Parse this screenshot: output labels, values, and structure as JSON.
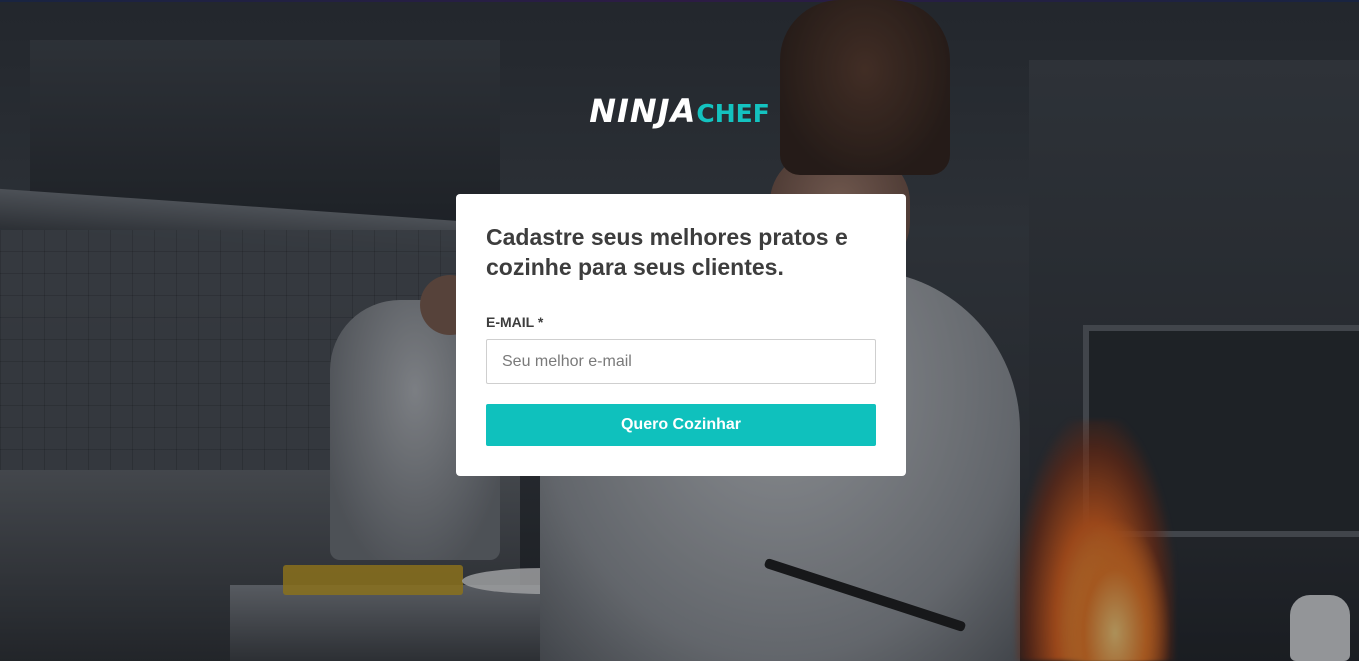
{
  "logo": {
    "part1": "NINJA",
    "part2": "CHEF",
    "part1_color": "#ffffff",
    "part2_color": "#14c3c0"
  },
  "form": {
    "title": "Cadastre seus melhores pratos e cozinhe para seus clientes.",
    "email_label": "E-MAIL *",
    "email_placeholder": "Seu melhor e-mail",
    "email_value": "",
    "submit_label": "Quero Cozinhar",
    "accent_color": "#0fc1bd"
  },
  "background": {
    "image": "chef-in-kitchen-photo"
  }
}
